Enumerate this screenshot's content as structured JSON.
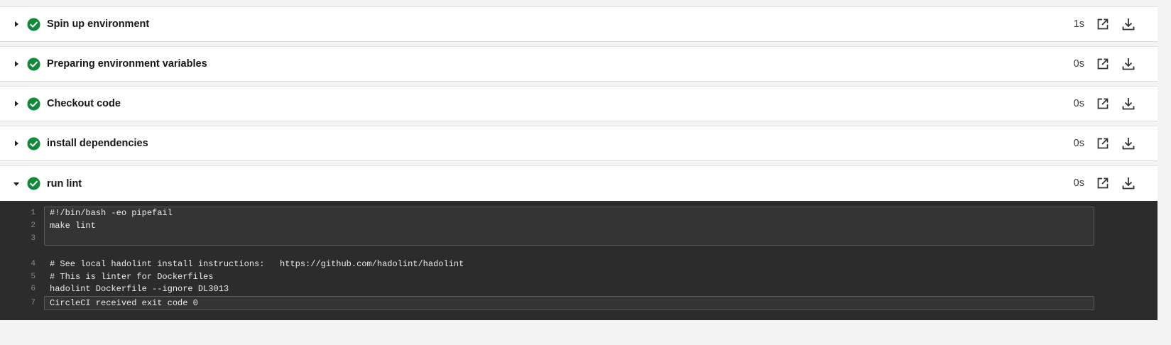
{
  "steps": [
    {
      "title": "Spin up environment",
      "duration": "1s",
      "expanded": false
    },
    {
      "title": "Preparing environment variables",
      "duration": "0s",
      "expanded": false
    },
    {
      "title": "Checkout code",
      "duration": "0s",
      "expanded": false
    },
    {
      "title": "install dependencies",
      "duration": "0s",
      "expanded": false
    },
    {
      "title": "run lint",
      "duration": "0s",
      "expanded": true
    }
  ],
  "output": {
    "lines": [
      {
        "num": "1",
        "text": "#!/bin/bash -eo pipefail"
      },
      {
        "num": "2",
        "text": "make lint"
      },
      {
        "num": "3",
        "text": ""
      },
      {
        "num": "4",
        "text": "# See local hadolint install instructions:   https://github.com/hadolint/hadolint"
      },
      {
        "num": "5",
        "text": "# This is linter for Dockerfiles"
      },
      {
        "num": "6",
        "text": "hadolint Dockerfile --ignore DL3013"
      },
      {
        "num": "7",
        "text": "CircleCI received exit code 0"
      }
    ]
  },
  "icons": {
    "status": "check-circle-icon",
    "collapsed": "caret-right-icon",
    "expanded": "caret-down-icon",
    "open_external": "external-link-icon",
    "download": "download-icon"
  },
  "colors": {
    "success": "#0e8a3a",
    "terminal_bg": "#2c2c2c"
  }
}
